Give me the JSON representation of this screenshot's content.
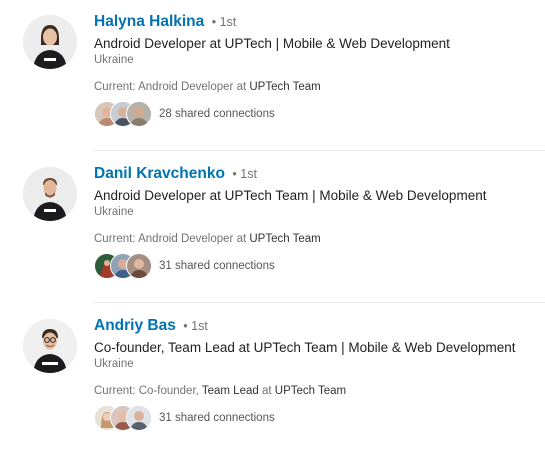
{
  "results": [
    {
      "name": "Halyna Halkina",
      "degree": "• 1st",
      "headline": "Android Developer at UPTech | Mobile & Web Development",
      "location": "Ukraine",
      "current_prefix": "Current:",
      "current_role": "Android Developer",
      "current_at": "at",
      "current_company": "UPTech Team",
      "shared_connections": "28 shared connections",
      "avatar_icon": "profile-photo-woman",
      "face_colors": [
        "#b98a74",
        "#4b5363",
        "#8a7d6d"
      ]
    },
    {
      "name": "Danil Kravchenko",
      "degree": "• 1st",
      "headline": "Android Developer at UPTech Team | Mobile & Web Development",
      "location": "Ukraine",
      "current_prefix": "Current:",
      "current_role": "Android Developer",
      "current_at": "at",
      "current_company": "UPTech Team",
      "shared_connections": "31 shared connections",
      "avatar_icon": "profile-photo-man",
      "face_colors": [
        "#a33a2c",
        "#3e5f8a",
        "#6b4a3c"
      ]
    },
    {
      "name": "Andriy Bas",
      "degree": "• 1st",
      "headline": "Co-founder, Team Lead at UPTech Team | Mobile & Web Development",
      "location": "Ukraine",
      "current_prefix": "Current:",
      "current_role_plain": "Co-founder,",
      "current_role": "Team Lead",
      "current_at": "at",
      "current_company": "UPTech Team",
      "shared_connections": "31 shared connections",
      "avatar_icon": "profile-photo-man-glasses",
      "face_colors": [
        "#c49a6c",
        "#9a5a4e",
        "#56606e"
      ]
    }
  ],
  "colors": {
    "name_link": "#0073b1",
    "secondary_text": "#737373",
    "divider": "#e6e9ec"
  }
}
